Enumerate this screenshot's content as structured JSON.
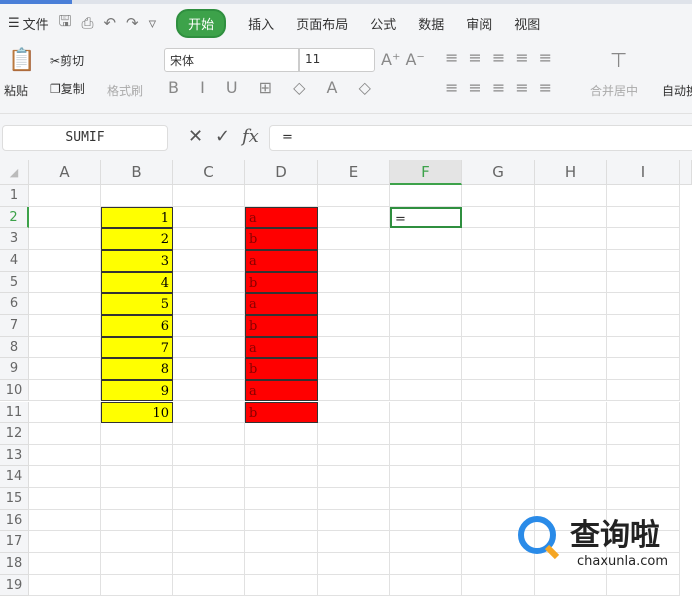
{
  "menu": {
    "file": "文件",
    "tabs": [
      "开始",
      "插入",
      "页面布局",
      "公式",
      "数据",
      "审阅",
      "视图"
    ]
  },
  "ribbon": {
    "paste": "粘贴",
    "cut": "剪切",
    "copy": "复制",
    "format_painter": "格式刷",
    "font": "宋体",
    "size": "11",
    "merge": "合并居中",
    "wrap": "自动换"
  },
  "formula": {
    "name_box": "SUMIF",
    "value": "="
  },
  "columns": [
    "A",
    "B",
    "C",
    "D",
    "E",
    "F",
    "G",
    "H",
    "I"
  ],
  "rows": [
    "1",
    "2",
    "3",
    "4",
    "5",
    "6",
    "7",
    "8",
    "9",
    "10",
    "11",
    "12",
    "13",
    "14",
    "15",
    "16",
    "17",
    "18",
    "19"
  ],
  "col_b": [
    "1",
    "2",
    "3",
    "4",
    "5",
    "6",
    "7",
    "8",
    "9",
    "10"
  ],
  "col_d": [
    "a",
    "b",
    "a",
    "b",
    "a",
    "b",
    "a",
    "b",
    "a",
    "b"
  ],
  "f2": "=",
  "colors": {
    "accent": "#3da24a",
    "yellow": "#ffff00",
    "red": "#ff0000"
  },
  "watermark": {
    "brand": "查询啦",
    "url": "chaxunla.com"
  }
}
